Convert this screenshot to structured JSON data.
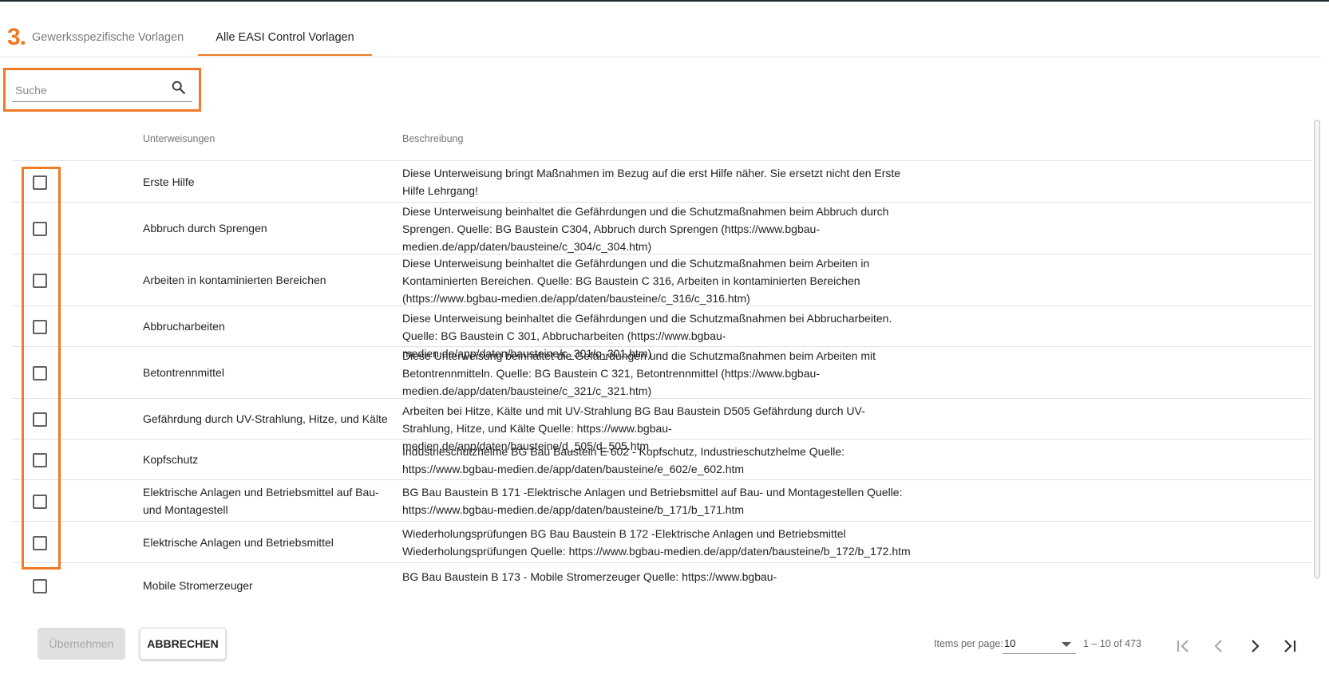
{
  "annotation": {
    "step_label": "3."
  },
  "tabs": [
    {
      "label": "Gewerksspezifische Vorlagen",
      "active": false
    },
    {
      "label": "Alle EASI Control Vorlagen",
      "active": true
    }
  ],
  "search": {
    "placeholder": "Suche",
    "value": ""
  },
  "table": {
    "columns": {
      "name": "Unterweisungen",
      "description": "Beschreibung"
    },
    "rows": [
      {
        "name": "Erste Hilfe",
        "description": "Diese Unterweisung bringt Maßnahmen im Bezug auf die erst Hilfe näher. Sie ersetzt nicht den Erste Hilfe Lehrgang!",
        "checked": false
      },
      {
        "name": "Abbruch durch Sprengen",
        "description": "Diese Unterweisung beinhaltet die Gefährdungen und die Schutzmaßnahmen beim Abbruch durch Sprengen. Quelle: BG Baustein C304, Abbruch durch Sprengen (https://www.bgbau-medien.de/app/daten/bausteine/c_304/c_304.htm)",
        "checked": false
      },
      {
        "name": "Arbeiten in kontaminierten Bereichen",
        "description": "Diese Unterweisung beinhaltet die Gefährdungen und die Schutzmaßnahmen beim Arbeiten in Kontaminierten Bereichen. Quelle: BG Baustein C 316, Arbeiten in kontaminierten Bereichen (https://www.bgbau-medien.de/app/daten/bausteine/c_316/c_316.htm)",
        "checked": false
      },
      {
        "name": "Abbrucharbeiten",
        "description": "Diese Unterweisung beinhaltet die Gefährdungen und die Schutzmaßnahmen bei Abbrucharbeiten. Quelle: BG Baustein C 301, Abbrucharbeiten (https://www.bgbau-medien.de/app/daten/bausteine/c_301/c_301.htm)",
        "checked": false
      },
      {
        "name": "Betontrennmittel",
        "description": "Diese Unterweisung beinhaltet die Gefährdungen und die Schutzmaßnahmen beim Arbeiten mit Betontrennmitteln. Quelle: BG Baustein C 321, Betontrennmittel (https://www.bgbau-medien.de/app/daten/bausteine/c_321/c_321.htm)",
        "checked": false
      },
      {
        "name": "Gefährdung durch UV-Strahlung, Hitze, und Kälte",
        "description": "Arbeiten bei Hitze, Kälte und mit UV-Strahlung BG Bau Baustein D505 Gefährdung durch UV-Strahlung, Hitze, und Kälte Quelle: https://www.bgbau-medien.de/app/daten/bausteine/d_505/d_505.htm",
        "checked": false
      },
      {
        "name": "Kopfschutz",
        "description": "Industrieschutzhelme BG Bau Baustein E 602 - Kopfschutz, Industrieschutzhelme Quelle: https://www.bgbau-medien.de/app/daten/bausteine/e_602/e_602.htm",
        "checked": false
      },
      {
        "name": "Elektrische Anlagen und Betriebsmittel auf Bau- und Montagestell",
        "description": "BG Bau Baustein B 171 -Elektrische Anlagen und Betriebsmittel auf Bau- und Montagestellen Quelle: https://www.bgbau-medien.de/app/daten/bausteine/b_171/b_171.htm",
        "checked": false
      },
      {
        "name": "Elektrische Anlagen und Betriebsmittel",
        "description": "Wiederholungsprüfungen BG Bau Baustein B 172 -Elektrische Anlagen und Betriebsmittel Wiederholungsprüfungen Quelle: https://www.bgbau-medien.de/app/daten/bausteine/b_172/b_172.htm",
        "checked": false
      },
      {
        "name": "Mobile Stromerzeuger",
        "description": "BG Bau Baustein B 173 - Mobile Stromerzeuger Quelle: https://www.bgbau-",
        "checked": false
      }
    ]
  },
  "actions": {
    "apply_label": "Übernehmen",
    "cancel_label": "ABBRECHEN"
  },
  "paginator": {
    "items_per_page_label": "Items per page:",
    "items_per_page_value": "10",
    "range_label": "1 – 10 of 473"
  },
  "icons": {
    "search": "search-icon",
    "first_page": "first-page-icon",
    "prev_page": "chevron-left-icon",
    "next_page": "chevron-right-icon",
    "last_page": "last-page-icon",
    "dropdown": "caret-down-icon"
  },
  "colors": {
    "accent": "#f07a25",
    "disabled_button_bg": "#e0e0e0",
    "divider": "#e2e2e2"
  }
}
